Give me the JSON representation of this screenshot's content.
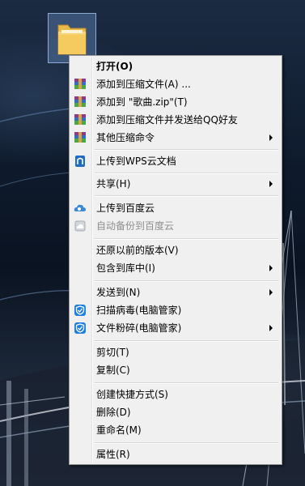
{
  "desktop": {
    "folder_icon": "folder-icon"
  },
  "menu": {
    "open": "打开(O)",
    "add_to_archive": "添加到压缩文件(A) ...",
    "add_to_zip": "添加到 \"歌曲.zip\"(T)",
    "add_and_send_qq": "添加到压缩文件并发送给QQ好友",
    "other_compress": "其他压缩命令",
    "upload_wps": "上传到WPS云文档",
    "share": "共享(H)",
    "upload_baidu": "上传到百度云",
    "auto_backup_baidu": "自动备份到百度云",
    "restore_previous": "还原以前的版本(V)",
    "include_in_library": "包含到库中(I)",
    "send_to": "发送到(N)",
    "scan_virus": "扫描病毒(电脑管家)",
    "file_shred": "文件粉碎(电脑管家)",
    "cut": "剪切(T)",
    "copy": "复制(C)",
    "create_shortcut": "创建快捷方式(S)",
    "delete": "删除(D)",
    "rename": "重命名(M)",
    "properties": "属性(R)"
  },
  "icons": {
    "winrar": "winrar-icon",
    "wps": "wps-cloud-icon",
    "baidu": "baidu-cloud-icon",
    "tencent": "tencent-shield-icon",
    "submenu": "chevron-right-icon"
  },
  "colors": {
    "menu_background": "#f0f0f0",
    "menu_border": "#979797",
    "hover": "#e5f3fb",
    "disabled_text": "#8f8f8f"
  }
}
